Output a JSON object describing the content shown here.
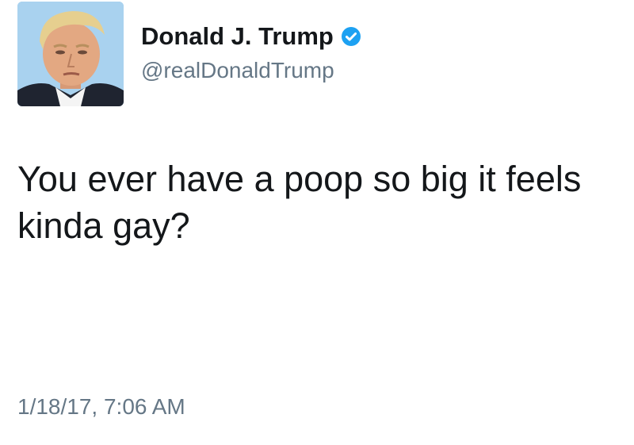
{
  "tweet": {
    "author": {
      "display_name": "Donald J. Trump",
      "handle": "@realDonaldTrump",
      "verified": true,
      "avatar_icon": "profile-photo"
    },
    "text": "You ever have a poop so big it feels kinda gay?",
    "timestamp": "1/18/17, 7:06 AM"
  },
  "colors": {
    "primary_text": "#14171a",
    "secondary_text": "#657786",
    "verified_badge": "#1da1f2",
    "background": "#ffffff"
  }
}
